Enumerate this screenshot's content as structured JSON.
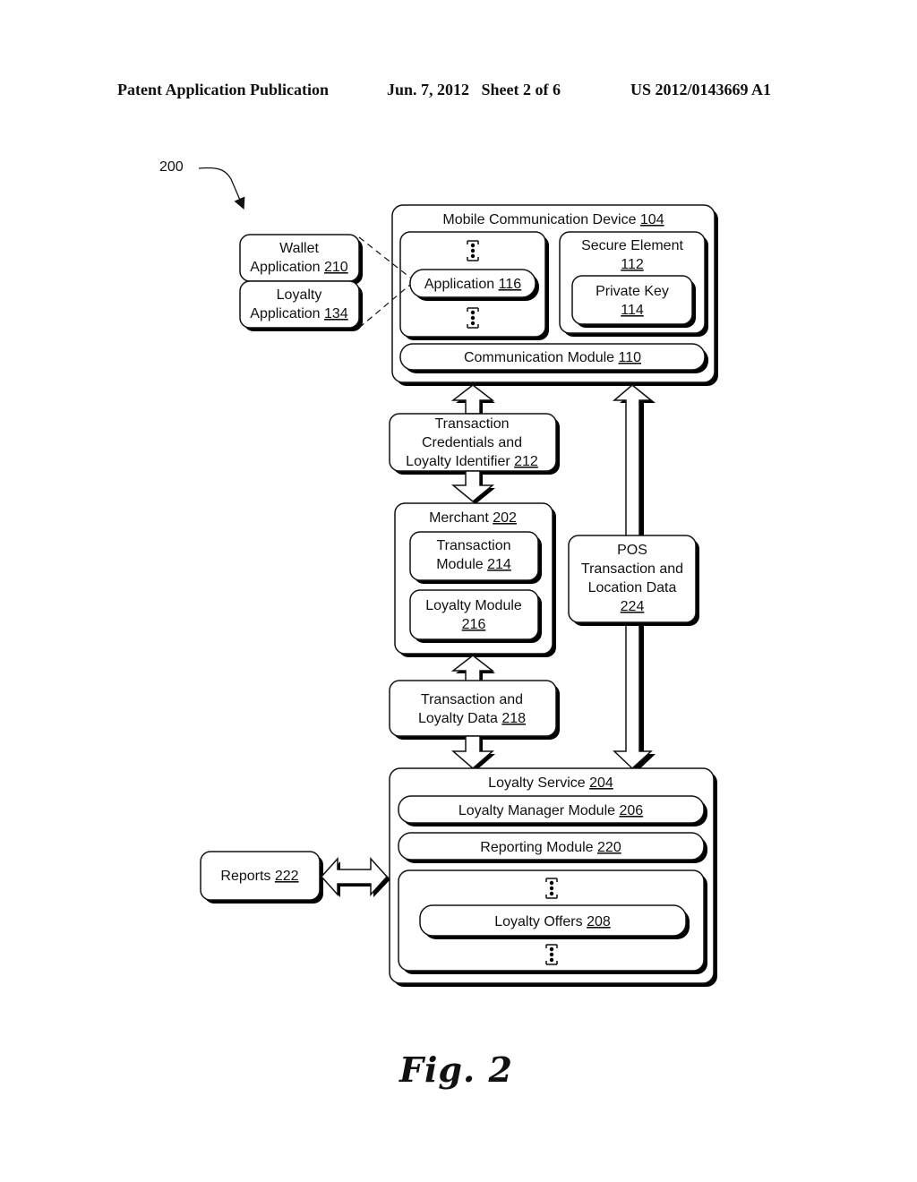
{
  "header": {
    "publication": "Patent Application Publication",
    "date_sheet": "Jun. 7, 2012   Sheet 2 of 6",
    "number": "US 2012/0143669 A1"
  },
  "figure_ref": "200",
  "figure_caption": "Fig. 2",
  "nodes": {
    "mobile_device": {
      "label": "Mobile Communication Device ",
      "ref": "104"
    },
    "app_container": {
      "label": "",
      "ref": ""
    },
    "application": {
      "label": "Application ",
      "ref": "116"
    },
    "secure_element": {
      "label": "Secure Element",
      "ref": "112"
    },
    "private_key": {
      "label": "Private Key",
      "ref": "114"
    },
    "comm_module": {
      "label": "Communication Module ",
      "ref": "110"
    },
    "wallet_app": {
      "label1": "Wallet",
      "label2": "Application ",
      "ref": "210"
    },
    "loyalty_app": {
      "label1": "Loyalty",
      "label2": "Application ",
      "ref": "134"
    },
    "credentials": {
      "label1": "Transaction",
      "label2": "Credentials and",
      "label3": "Loyalty Identifier ",
      "ref": "212"
    },
    "merchant": {
      "label": "Merchant ",
      "ref": "202"
    },
    "transaction_module": {
      "label1": "Transaction",
      "label2": "Module ",
      "ref": "214"
    },
    "loyalty_module": {
      "label1": "Loyalty Module",
      "ref": "216"
    },
    "pos_data": {
      "label1": "POS",
      "label2": "Transaction and",
      "label3": "Location Data",
      "ref": "224"
    },
    "txn_loyalty_data": {
      "label1": "Transaction and",
      "label2": "Loyalty Data ",
      "ref": "218"
    },
    "loyalty_service": {
      "label": "Loyalty Service ",
      "ref": "204"
    },
    "loyalty_manager": {
      "label": "Loyalty Manager Module ",
      "ref": "206"
    },
    "reporting_module": {
      "label": "Reporting Module ",
      "ref": "220"
    },
    "loyalty_offers": {
      "label": "Loyalty Offers ",
      "ref": "208"
    },
    "reports": {
      "label": "Reports ",
      "ref": "222"
    }
  }
}
